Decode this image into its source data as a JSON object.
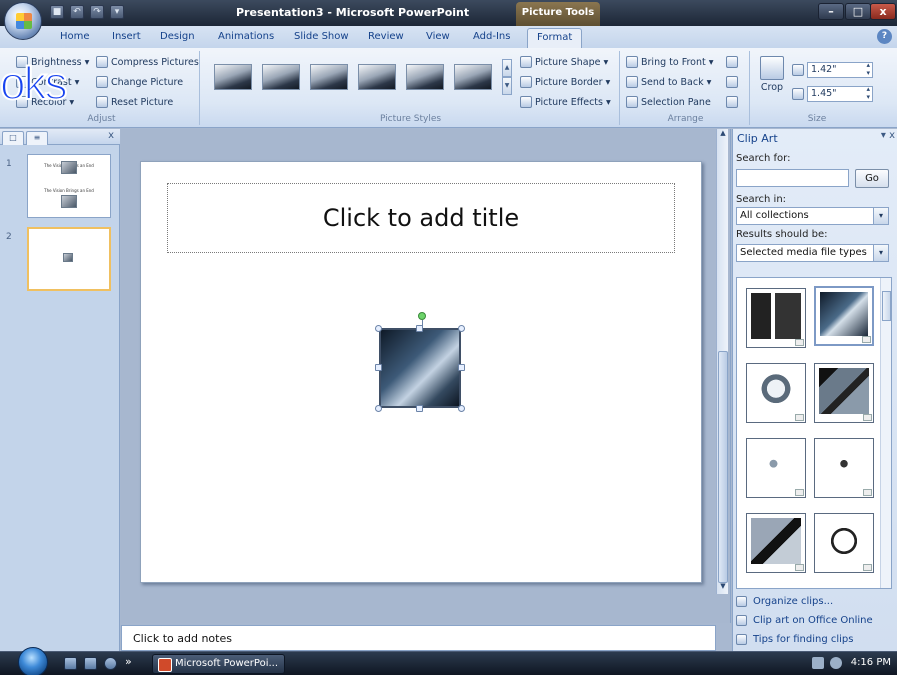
{
  "window": {
    "title": "Presentation3 - Microsoft PowerPoint",
    "context_tab": "Picture Tools",
    "minimize": "–",
    "maximize": "□",
    "close": "x"
  },
  "quick_access": [
    "■",
    "↶",
    "↷",
    "▾"
  ],
  "ribbon_tabs": [
    "Home",
    "Insert",
    "Design",
    "Animations",
    "Slide Show",
    "Review",
    "View",
    "Add-Ins",
    "Format"
  ],
  "active_tab": "Format",
  "help": "?",
  "ribbon": {
    "adjust": {
      "brightness": "Brightness ▾",
      "contrast": "Contrast ▾",
      "recolor": "Recolor ▾",
      "compress": "Compress Pictures",
      "change": "Change Picture",
      "reset": "Reset Picture",
      "label": "Adjust"
    },
    "picture_styles": {
      "label": "Picture Styles",
      "shape": "Picture Shape ▾",
      "border": "Picture Border ▾",
      "effects": "Picture Effects ▾"
    },
    "arrange": {
      "label": "Arrange",
      "bring_front": "Bring to Front ▾",
      "send_back": "Send to Back ▾",
      "selection_pane": "Selection Pane"
    },
    "size": {
      "label": "Size",
      "crop": "Crop",
      "height": "1.42\"",
      "width": "1.45\""
    }
  },
  "logo_overlay": "oks",
  "left_pane": {
    "tab_slides": "□",
    "tab_outline": "≡",
    "close": "x",
    "slides": [
      {
        "number": "1",
        "title_line1": "The Vision Brings an End",
        "title_line2": "The Vision Brings an End"
      },
      {
        "number": "2"
      }
    ]
  },
  "slide": {
    "title_placeholder": "Click to add title"
  },
  "notes_placeholder": "Click to add notes",
  "clip_art": {
    "title": "Clip Art",
    "pane_controls": "▾  x",
    "search_for_label": "Search for:",
    "search_value": "",
    "go_button": "Go",
    "search_in_label": "Search in:",
    "search_in_value": "All collections",
    "results_label": "Results should be:",
    "results_value": "Selected media file types",
    "links": [
      "Organize clips...",
      "Clip art on Office Online",
      "Tips for finding clips"
    ]
  },
  "taskbar": {
    "task_button": "Microsoft PowerPoi...",
    "time": "4:16 PM",
    "chevron": "»"
  }
}
